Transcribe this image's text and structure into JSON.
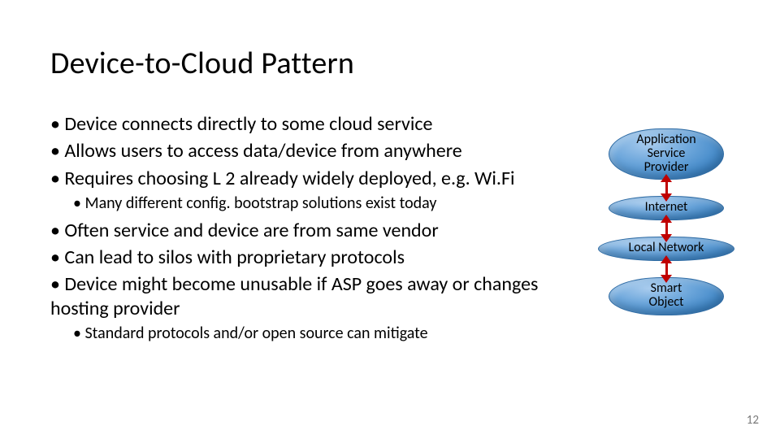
{
  "title": "Device-to-Cloud Pattern",
  "bullets": {
    "b1": "Device connects directly to some cloud service",
    "b2": "Allows users to access data/device from anywhere",
    "b3": "Requires choosing L 2 already widely deployed, e.g. Wi.Fi",
    "b3a": "Many different config. bootstrap solutions exist today",
    "b4": "Often service and device are from same vendor",
    "b5": "Can lead to silos with proprietary protocols",
    "b6": "Device might become unusable if ASP goes away or changes hosting provider",
    "b6a": "Standard protocols and/or open source can mitigate"
  },
  "diagram": {
    "node1_line1": "Application",
    "node1_line2": "Service",
    "node1_line3": "Provider",
    "node2": "Internet",
    "node3": "Local Network",
    "node4_line1": "Smart",
    "node4_line2": "Object"
  },
  "slide_number": "12"
}
